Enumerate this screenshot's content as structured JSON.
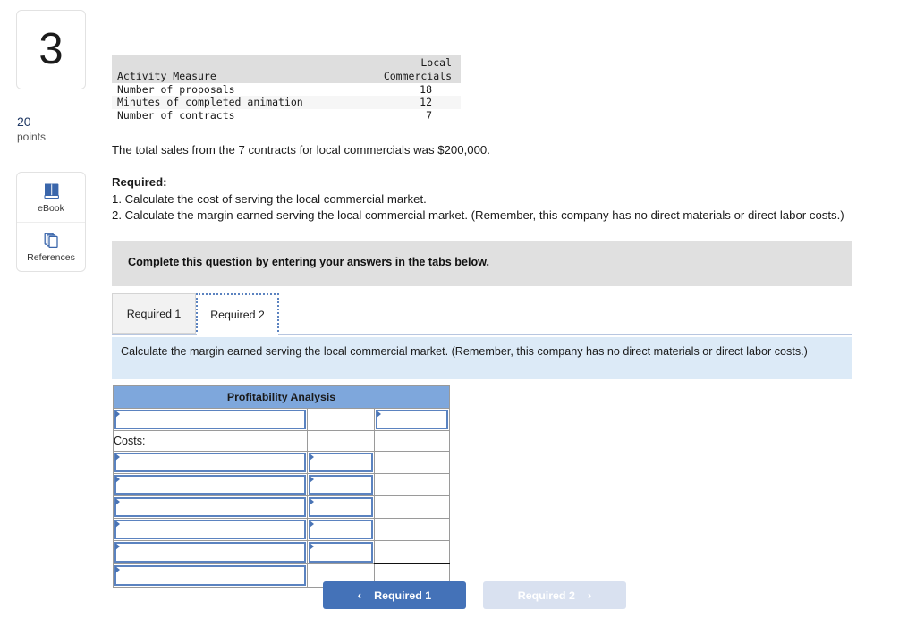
{
  "left_rail": {
    "question_number": "3",
    "points_value": "20",
    "points_label": "points",
    "tools": [
      {
        "label": "eBook",
        "icon": "book-icon"
      },
      {
        "label": "References",
        "icon": "pages-stack-icon"
      }
    ]
  },
  "data_table": {
    "header": {
      "col1": "",
      "col2_line1": "Local",
      "col2_line2": "Commercials"
    },
    "subheader_label": "Activity Measure",
    "rows": [
      {
        "label": "Number of proposals",
        "value": "18"
      },
      {
        "label": "Minutes of completed animation",
        "value": "12"
      },
      {
        "label": "Number of contracts",
        "value": "7"
      }
    ]
  },
  "narrative": {
    "sales_line": "The total sales from the 7 contracts for local commercials was $200,000.",
    "required_heading": "Required:",
    "requirement_1": "1. Calculate the cost of serving the local commercial market.",
    "requirement_2": "2. Calculate the margin earned serving the local commercial market. (Remember, this company has no direct materials or direct labor costs.)"
  },
  "instruction_banner": {
    "text": "Complete this question by entering your answers in the tabs below."
  },
  "tabs": [
    {
      "label": "Required 1",
      "active": false
    },
    {
      "label": "Required 2",
      "active": true
    }
  ],
  "question_panel": {
    "text": "Calculate the margin earned serving the local commercial market. (Remember, this company has no direct materials or direct labor costs.)"
  },
  "profitability_analysis": {
    "title": "Profitability Analysis",
    "rows": [
      {
        "label": "",
        "label_type": "input",
        "col2": "",
        "col2_type": "plain",
        "col3": "",
        "col3_type": "input"
      },
      {
        "label": "Costs:",
        "label_type": "static",
        "col2": "",
        "col2_type": "plain",
        "col3": "",
        "col3_type": "plain"
      },
      {
        "label": "",
        "label_type": "input",
        "col2": "",
        "col2_type": "input",
        "col3": "",
        "col3_type": "plain"
      },
      {
        "label": "",
        "label_type": "input",
        "col2": "",
        "col2_type": "input",
        "col3": "",
        "col3_type": "plain"
      },
      {
        "label": "",
        "label_type": "input",
        "col2": "",
        "col2_type": "input",
        "col3": "",
        "col3_type": "plain"
      },
      {
        "label": "",
        "label_type": "input",
        "col2": "",
        "col2_type": "input",
        "col3": "",
        "col3_type": "plain"
      },
      {
        "label": "",
        "label_type": "input",
        "col2": "",
        "col2_type": "input",
        "col3": "",
        "col3_type": "plain"
      },
      {
        "label": "",
        "label_type": "input",
        "col2": "",
        "col2_type": "plain",
        "col3": "",
        "col3_type": "total"
      }
    ]
  },
  "nav_buttons": {
    "prev": {
      "label": "Required 1",
      "chevron": "‹",
      "enabled": true
    },
    "next": {
      "label": "Required 2",
      "chevron": "›",
      "enabled": false
    }
  },
  "colors": {
    "accent_blue": "#4472b8",
    "table_header_blue": "#7ea7dc",
    "panel_blue": "#dceaf7",
    "banner_gray": "#e0e0e0",
    "input_border_blue": "#5b83c0",
    "points_navy": "#1f3864",
    "disabled_button": "#d9e1f0"
  }
}
